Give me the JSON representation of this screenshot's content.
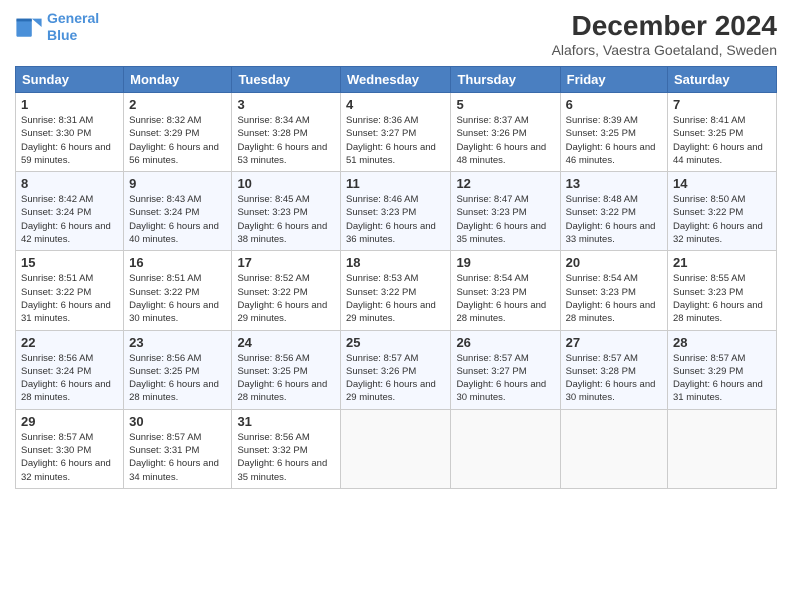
{
  "logo": {
    "line1": "General",
    "line2": "Blue"
  },
  "title": "December 2024",
  "subtitle": "Alafors, Vaestra Goetaland, Sweden",
  "headers": [
    "Sunday",
    "Monday",
    "Tuesday",
    "Wednesday",
    "Thursday",
    "Friday",
    "Saturday"
  ],
  "weeks": [
    [
      {
        "day": "1",
        "sunrise": "8:31 AM",
        "sunset": "3:30 PM",
        "daylight": "6 hours and 59 minutes."
      },
      {
        "day": "2",
        "sunrise": "8:32 AM",
        "sunset": "3:29 PM",
        "daylight": "6 hours and 56 minutes."
      },
      {
        "day": "3",
        "sunrise": "8:34 AM",
        "sunset": "3:28 PM",
        "daylight": "6 hours and 53 minutes."
      },
      {
        "day": "4",
        "sunrise": "8:36 AM",
        "sunset": "3:27 PM",
        "daylight": "6 hours and 51 minutes."
      },
      {
        "day": "5",
        "sunrise": "8:37 AM",
        "sunset": "3:26 PM",
        "daylight": "6 hours and 48 minutes."
      },
      {
        "day": "6",
        "sunrise": "8:39 AM",
        "sunset": "3:25 PM",
        "daylight": "6 hours and 46 minutes."
      },
      {
        "day": "7",
        "sunrise": "8:41 AM",
        "sunset": "3:25 PM",
        "daylight": "6 hours and 44 minutes."
      }
    ],
    [
      {
        "day": "8",
        "sunrise": "8:42 AM",
        "sunset": "3:24 PM",
        "daylight": "6 hours and 42 minutes."
      },
      {
        "day": "9",
        "sunrise": "8:43 AM",
        "sunset": "3:24 PM",
        "daylight": "6 hours and 40 minutes."
      },
      {
        "day": "10",
        "sunrise": "8:45 AM",
        "sunset": "3:23 PM",
        "daylight": "6 hours and 38 minutes."
      },
      {
        "day": "11",
        "sunrise": "8:46 AM",
        "sunset": "3:23 PM",
        "daylight": "6 hours and 36 minutes."
      },
      {
        "day": "12",
        "sunrise": "8:47 AM",
        "sunset": "3:23 PM",
        "daylight": "6 hours and 35 minutes."
      },
      {
        "day": "13",
        "sunrise": "8:48 AM",
        "sunset": "3:22 PM",
        "daylight": "6 hours and 33 minutes."
      },
      {
        "day": "14",
        "sunrise": "8:50 AM",
        "sunset": "3:22 PM",
        "daylight": "6 hours and 32 minutes."
      }
    ],
    [
      {
        "day": "15",
        "sunrise": "8:51 AM",
        "sunset": "3:22 PM",
        "daylight": "6 hours and 31 minutes."
      },
      {
        "day": "16",
        "sunrise": "8:51 AM",
        "sunset": "3:22 PM",
        "daylight": "6 hours and 30 minutes."
      },
      {
        "day": "17",
        "sunrise": "8:52 AM",
        "sunset": "3:22 PM",
        "daylight": "6 hours and 29 minutes."
      },
      {
        "day": "18",
        "sunrise": "8:53 AM",
        "sunset": "3:22 PM",
        "daylight": "6 hours and 29 minutes."
      },
      {
        "day": "19",
        "sunrise": "8:54 AM",
        "sunset": "3:23 PM",
        "daylight": "6 hours and 28 minutes."
      },
      {
        "day": "20",
        "sunrise": "8:54 AM",
        "sunset": "3:23 PM",
        "daylight": "6 hours and 28 minutes."
      },
      {
        "day": "21",
        "sunrise": "8:55 AM",
        "sunset": "3:23 PM",
        "daylight": "6 hours and 28 minutes."
      }
    ],
    [
      {
        "day": "22",
        "sunrise": "8:56 AM",
        "sunset": "3:24 PM",
        "daylight": "6 hours and 28 minutes."
      },
      {
        "day": "23",
        "sunrise": "8:56 AM",
        "sunset": "3:25 PM",
        "daylight": "6 hours and 28 minutes."
      },
      {
        "day": "24",
        "sunrise": "8:56 AM",
        "sunset": "3:25 PM",
        "daylight": "6 hours and 28 minutes."
      },
      {
        "day": "25",
        "sunrise": "8:57 AM",
        "sunset": "3:26 PM",
        "daylight": "6 hours and 29 minutes."
      },
      {
        "day": "26",
        "sunrise": "8:57 AM",
        "sunset": "3:27 PM",
        "daylight": "6 hours and 30 minutes."
      },
      {
        "day": "27",
        "sunrise": "8:57 AM",
        "sunset": "3:28 PM",
        "daylight": "6 hours and 30 minutes."
      },
      {
        "day": "28",
        "sunrise": "8:57 AM",
        "sunset": "3:29 PM",
        "daylight": "6 hours and 31 minutes."
      }
    ],
    [
      {
        "day": "29",
        "sunrise": "8:57 AM",
        "sunset": "3:30 PM",
        "daylight": "6 hours and 32 minutes."
      },
      {
        "day": "30",
        "sunrise": "8:57 AM",
        "sunset": "3:31 PM",
        "daylight": "6 hours and 34 minutes."
      },
      {
        "day": "31",
        "sunrise": "8:56 AM",
        "sunset": "3:32 PM",
        "daylight": "6 hours and 35 minutes."
      },
      null,
      null,
      null,
      null
    ]
  ]
}
